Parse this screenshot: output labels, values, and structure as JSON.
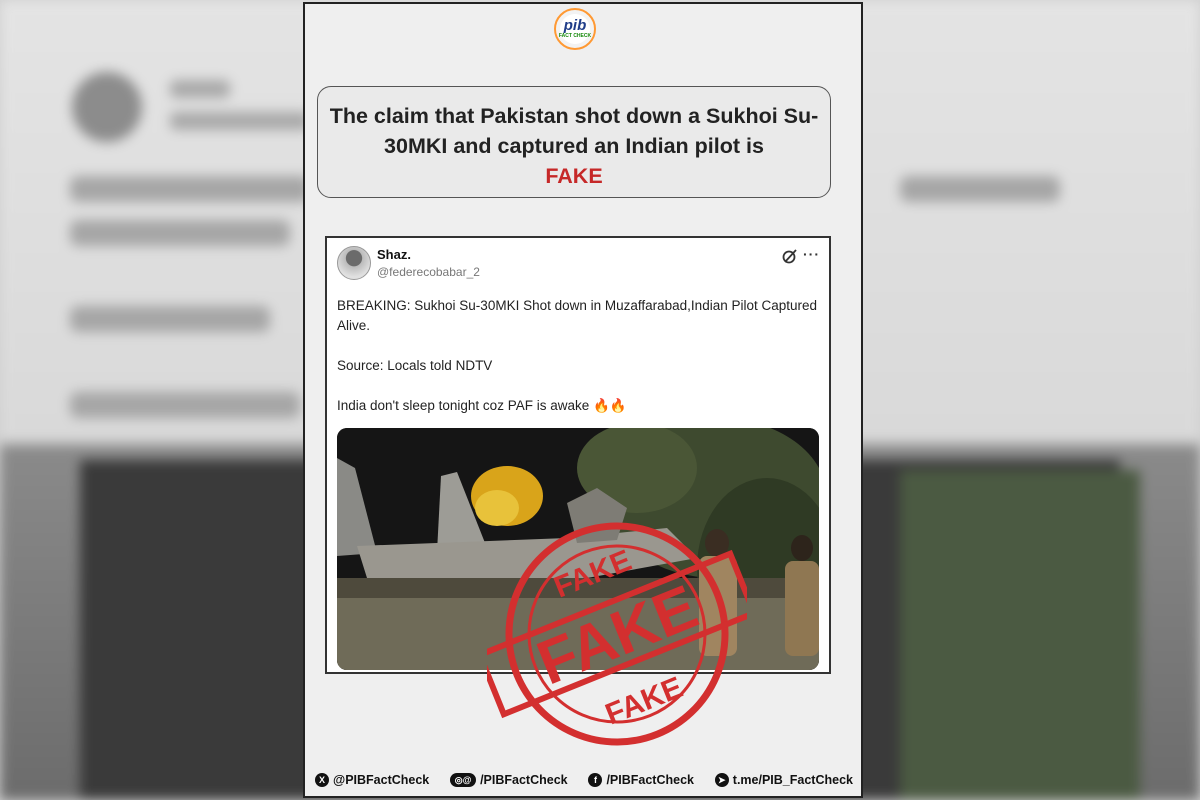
{
  "header": {
    "logo_main": "pib",
    "logo_sub": "FACT CHECK"
  },
  "claim": {
    "text": "The claim that Pakistan shot down a Sukhoi Su-30MKI and captured an Indian pilot is",
    "verdict": "FAKE"
  },
  "tweet": {
    "user_name": "Shaz.",
    "handle": "@federecobabar_2",
    "line1": "BREAKING: Sukhoi Su-30MKI Shot down in Muzaffarabad,Indian Pilot Captured Alive.",
    "line2": "Source: Locals told NDTV",
    "line3": "India don't sleep tonight coz PAF is awake",
    "emoji": "🔥🔥",
    "icons": [
      "grok-icon",
      "more-icon"
    ]
  },
  "stamp": {
    "top": "FAKE",
    "center": "FAKE",
    "bottom": "FAKE",
    "color": "#d32f2f"
  },
  "footer": {
    "items": [
      {
        "icon": "x-icon",
        "glyph": "X",
        "label": "@PIBFactCheck"
      },
      {
        "icon": "instagram-threads-icon",
        "glyph": "◎@",
        "label": "/PIBFactCheck"
      },
      {
        "icon": "facebook-icon",
        "glyph": "f",
        "label": "/PIBFactCheck"
      },
      {
        "icon": "telegram-icon",
        "glyph": "➤",
        "label": "t.me/PIB_FactCheck"
      }
    ]
  }
}
